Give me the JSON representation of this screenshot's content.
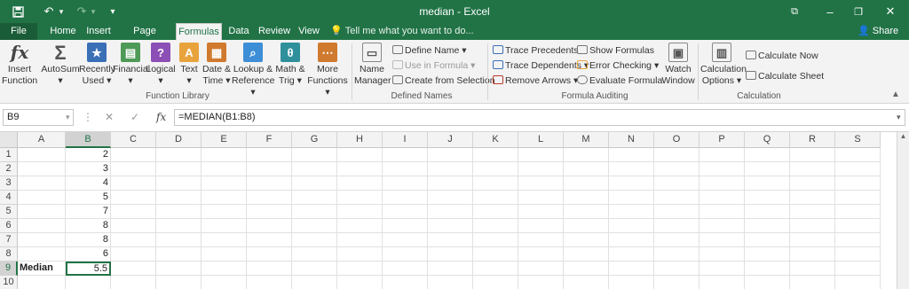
{
  "titlebar": {
    "title": "median - Excel",
    "save_icon": "save-icon",
    "undo_icon": "undo-icon",
    "redo_icon": "redo-icon"
  },
  "tabs": [
    {
      "label": "File"
    },
    {
      "label": "Home"
    },
    {
      "label": "Insert"
    },
    {
      "label": "Page Layout"
    },
    {
      "label": "Formulas"
    },
    {
      "label": "Data"
    },
    {
      "label": "Review"
    },
    {
      "label": "View"
    }
  ],
  "tell_me": "Tell me what you want to do...",
  "share": "Share",
  "ribbon": {
    "insert_function": {
      "line1": "Insert",
      "line2": "Function",
      "glyph": "fx"
    },
    "autosum": {
      "line1": "AutoSum",
      "line2": "▾",
      "glyph": "Σ"
    },
    "recently_used": {
      "line1": "Recently",
      "line2": "Used ▾",
      "glyph": "★"
    },
    "financial": {
      "line1": "Financial",
      "line2": "▾",
      "glyph": "▤"
    },
    "logical": {
      "line1": "Logical",
      "line2": "▾",
      "glyph": "?"
    },
    "text": {
      "line1": "Text",
      "line2": "▾",
      "glyph": "A"
    },
    "date_time": {
      "line1": "Date &",
      "line2": "Time ▾",
      "glyph": "▦"
    },
    "lookup": {
      "line1": "Lookup &",
      "line2": "Reference ▾",
      "glyph": "⌕"
    },
    "math": {
      "line1": "Math &",
      "line2": "Trig ▾",
      "glyph": "θ"
    },
    "more": {
      "line1": "More",
      "line2": "Functions ▾",
      "glyph": "⋯"
    },
    "group_function_library": "Function Library",
    "name_manager": {
      "line1": "Name",
      "line2": "Manager",
      "glyph": "▭"
    },
    "define_name": "Define Name ▾",
    "use_in_formula": "Use in Formula ▾",
    "create_from_selection": "Create from Selection",
    "group_defined_names": "Defined Names",
    "trace_precedents": "Trace Precedents",
    "trace_dependents": "Trace Dependents ▾",
    "remove_arrows": "Remove Arrows ▾",
    "show_formulas": "Show Formulas",
    "error_checking": "Error Checking ▾",
    "evaluate_formula": "Evaluate Formula",
    "watch_window": {
      "line1": "Watch",
      "line2": "Window",
      "glyph": "▣"
    },
    "group_formula_auditing": "Formula Auditing",
    "calculation_options": {
      "line1": "Calculation",
      "line2": "Options ▾",
      "glyph": "▥"
    },
    "calculate_now": "Calculate Now",
    "calculate_sheet": "Calculate Sheet",
    "group_calculation": "Calculation"
  },
  "formula_bar": {
    "name_box": "B9",
    "fx": "fx",
    "cancel": "✕",
    "enter": "✓",
    "formula": "=MEDIAN(B1:B8)"
  },
  "columns": [
    "A",
    "B",
    "C",
    "D",
    "E",
    "F",
    "G",
    "H",
    "I",
    "J",
    "K",
    "L",
    "M",
    "N",
    "O",
    "P",
    "Q",
    "R",
    "S"
  ],
  "rows": [
    {
      "num": "1",
      "a": "",
      "b": "2"
    },
    {
      "num": "2",
      "a": "",
      "b": "3"
    },
    {
      "num": "3",
      "a": "",
      "b": "4"
    },
    {
      "num": "4",
      "a": "",
      "b": "5"
    },
    {
      "num": "5",
      "a": "",
      "b": "7"
    },
    {
      "num": "6",
      "a": "",
      "b": "8"
    },
    {
      "num": "7",
      "a": "",
      "b": "8"
    },
    {
      "num": "8",
      "a": "",
      "b": "6"
    },
    {
      "num": "9",
      "a": "Median",
      "b": "5.5"
    },
    {
      "num": "10",
      "a": "",
      "b": ""
    }
  ],
  "colors": {
    "accent": "#217346"
  }
}
